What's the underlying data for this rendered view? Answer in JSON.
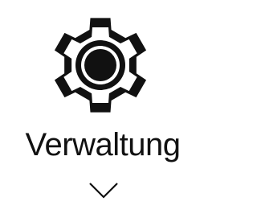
{
  "tile": {
    "label": "Verwaltung",
    "icon": "gear-icon",
    "expand_icon": "chevron-down-icon"
  },
  "colors": {
    "background": "#ffffff",
    "foreground": "#111111"
  }
}
